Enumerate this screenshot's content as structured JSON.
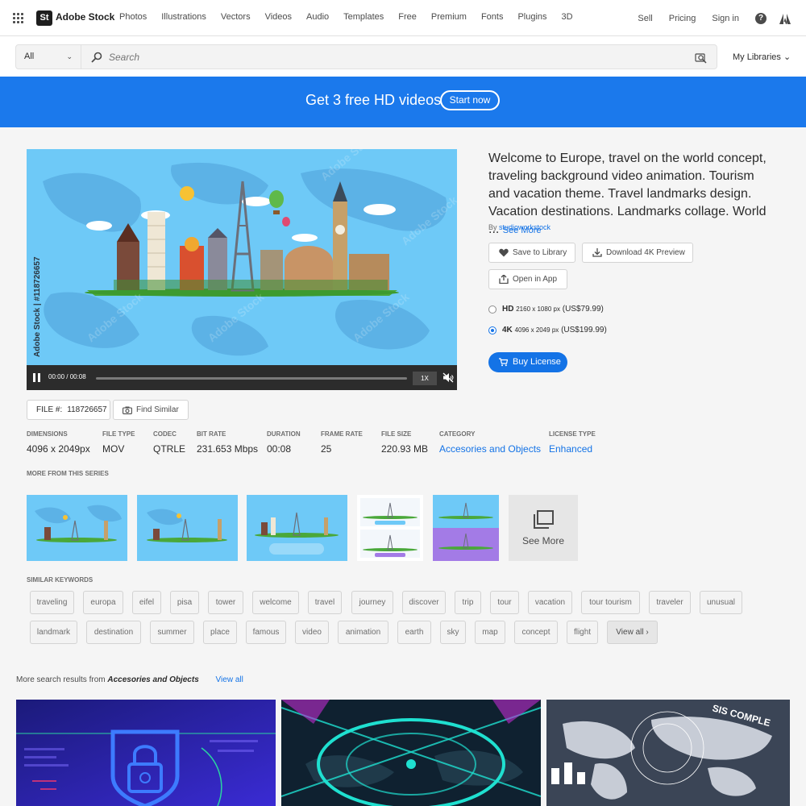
{
  "nav": {
    "logo_mark": "St",
    "logo_text": "Adobe Stock",
    "links": [
      "Photos",
      "Illustrations",
      "Vectors",
      "Videos",
      "Audio",
      "Templates",
      "Free",
      "Premium",
      "Fonts",
      "Plugins",
      "3D"
    ],
    "sell": "Sell",
    "pricing": "Pricing",
    "sign_in": "Sign in",
    "help_glyph": "?"
  },
  "search": {
    "scope": "All",
    "placeholder": "Search",
    "my_libraries": "My Libraries"
  },
  "banner": {
    "text": "Get 3 free HD videos",
    "button": "Start now"
  },
  "player": {
    "watermark": "Adobe Stock | #118726657",
    "time": "00:00 / 00:08",
    "speed": "1X",
    "progress": 0
  },
  "asset": {
    "title": "Welcome to Europe, travel on the world concept, traveling background video animation. Tourism and vacation theme. Travel landmarks design. Vacation destinations. Landmarks collage. World ...",
    "see_more": "See More",
    "by": "By",
    "author": "studioworkstock",
    "save_label": "Save to Library",
    "download_label": "Download 4K Preview",
    "open_label": "Open in App",
    "options": [
      {
        "name": "HD",
        "dims": "2160 x 1080 px",
        "price": "(US$79.99)",
        "selected": false
      },
      {
        "name": "4K",
        "dims": "4096 x 2049 px",
        "price": "(US$199.99)",
        "selected": true
      }
    ],
    "buy_label": "Buy License",
    "file_label": "FILE #:",
    "file_number": "118726657",
    "find_similar": "Find Similar"
  },
  "specs": [
    {
      "key": "DIMENSIONS",
      "value": "4096 x 2049px"
    },
    {
      "key": "FILE TYPE",
      "value": "MOV"
    },
    {
      "key": "CODEC",
      "value": "QTRLE"
    },
    {
      "key": "BIT RATE",
      "value": "231.653 Mbps"
    },
    {
      "key": "DURATION",
      "value": "00:08"
    },
    {
      "key": "FRAME RATE",
      "value": "25"
    },
    {
      "key": "FILE SIZE",
      "value": "220.93 MB"
    },
    {
      "key": "CATEGORY",
      "value": "Accesories and Objects"
    },
    {
      "key": "LICENSE TYPE",
      "value": "Enhanced"
    }
  ],
  "series": {
    "label": "MORE FROM THIS SERIES",
    "see_more": "See More"
  },
  "keywords": {
    "label": "SIMILAR KEYWORDS",
    "items": [
      "traveling",
      "europa",
      "eifel",
      "pisa",
      "tower",
      "welcome",
      "travel",
      "journey",
      "discover",
      "trip",
      "tour",
      "vacation",
      "tour tourism",
      "traveler",
      "unusual",
      "landmark",
      "destination",
      "summer",
      "place",
      "famous",
      "video",
      "animation",
      "earth",
      "sky",
      "map",
      "concept",
      "flight"
    ],
    "view_all": "View all ›"
  },
  "more_results": {
    "prefix": "More search results from",
    "category": "Accesories and Objects",
    "view_all": "View all"
  },
  "colors": {
    "accent": "#1473e6",
    "banner": "#1b79ec",
    "sky": "#6ec9f7"
  }
}
